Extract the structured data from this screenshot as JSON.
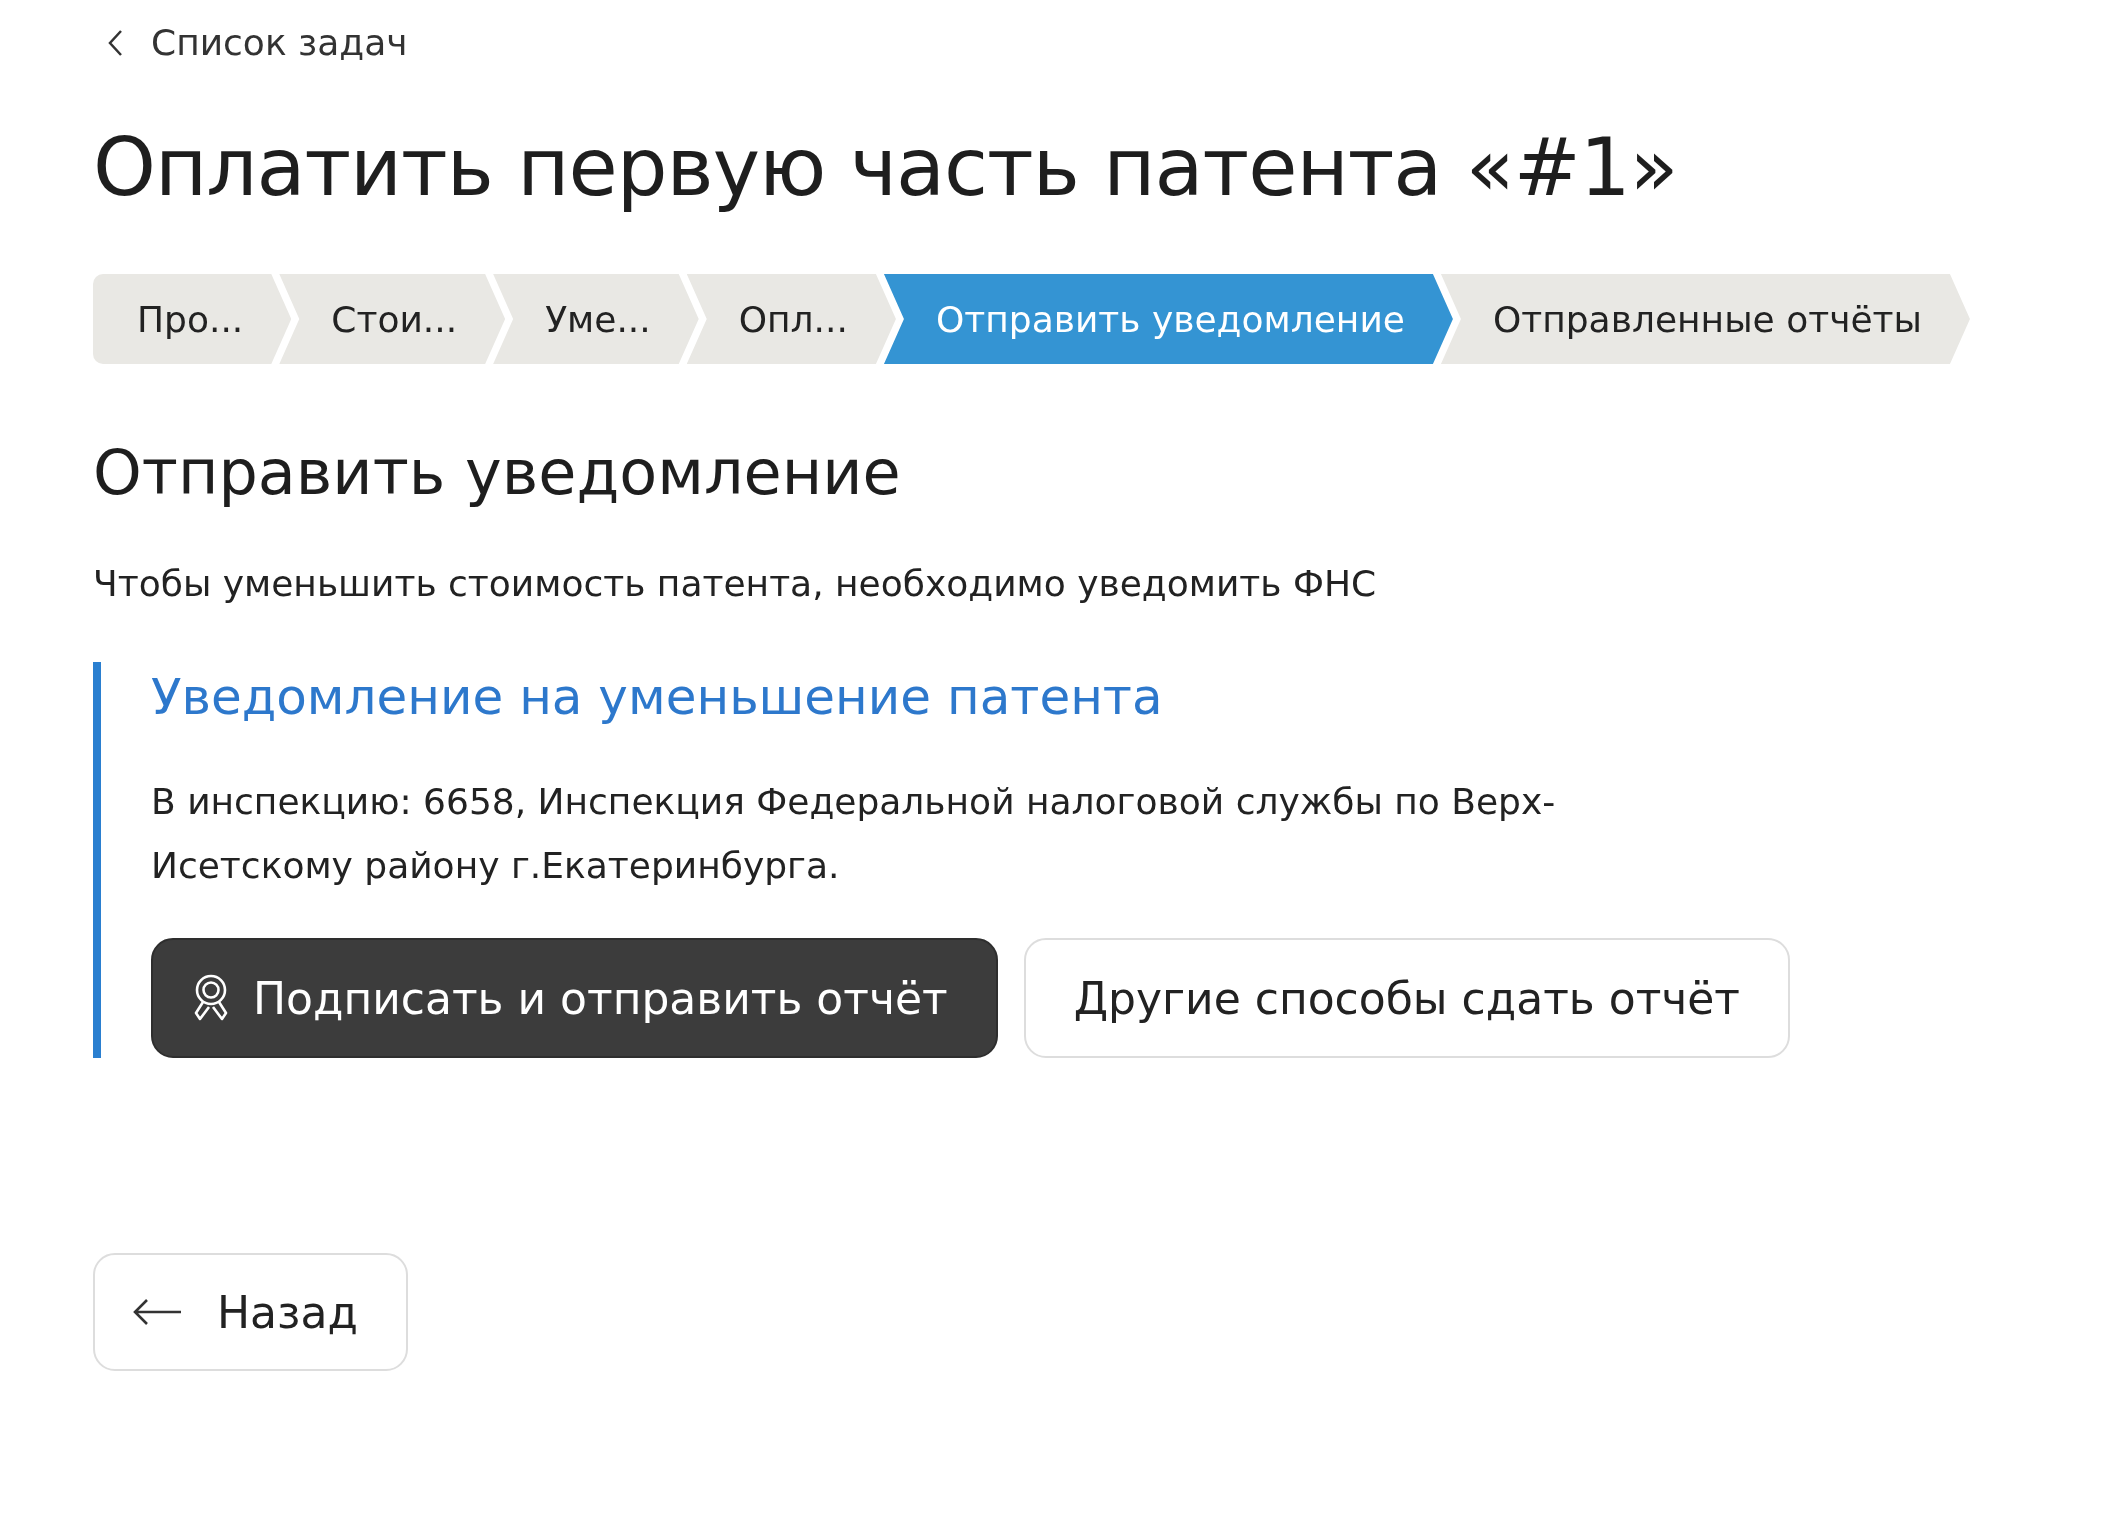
{
  "back_link": {
    "label": "Список задач"
  },
  "title": "Оплатить первую часть патента «#1»",
  "steps": [
    {
      "label": "Про...",
      "selected": false
    },
    {
      "label": "Стои...",
      "selected": false
    },
    {
      "label": "Уме...",
      "selected": false
    },
    {
      "label": "Опл...",
      "selected": false
    },
    {
      "label": "Отправить уведомление",
      "selected": true
    },
    {
      "label": "Отправленные отчёты",
      "selected": false
    }
  ],
  "section_title": "Отправить уведомление",
  "description": "Чтобы уменьшить стоимость патента, необходимо уведомить ФНС",
  "notice": {
    "title": "Уведомление на уменьшение патента",
    "text": "В инспекцию: 6658, Инспекция Федеральной налоговой службы по Верх-Исетскому району г.Екатеринбурга.",
    "primary_button": "Подписать и отправить отчёт",
    "secondary_button": "Другие способы сдать отчёт"
  },
  "back_button": "Назад"
}
